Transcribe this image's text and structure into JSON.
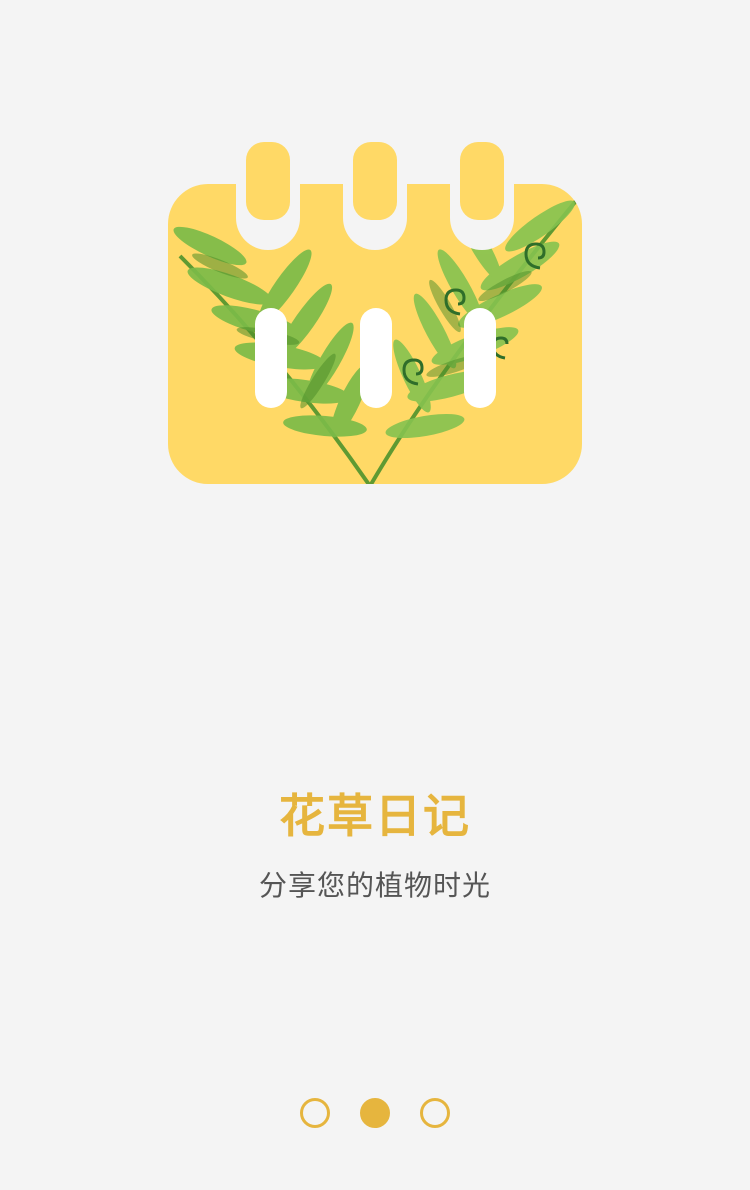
{
  "hero": {
    "icon": "calendar-leaf-illustration"
  },
  "title": "花草日记",
  "subtitle": "分享您的植物时光",
  "pager": {
    "count": 3,
    "active_index": 1
  },
  "colors": {
    "accent": "#e6b53e",
    "calendar_fill": "#ffd966",
    "leaf_green": "#6fae3b",
    "background": "#f4f4f4"
  }
}
